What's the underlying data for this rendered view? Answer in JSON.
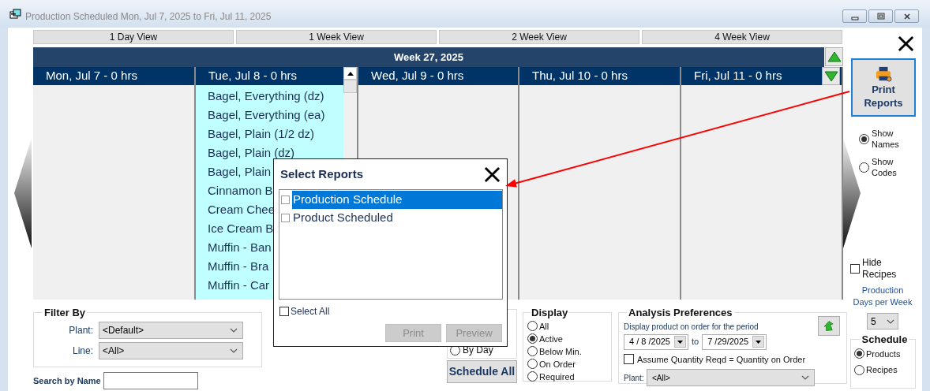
{
  "window": {
    "title": "Production Scheduled Mon, Jul 7, 2025 to Fri, Jul 11, 2025"
  },
  "view_buttons": [
    {
      "label": "1 Day View"
    },
    {
      "label": "1 Week View"
    },
    {
      "label": "2 Week View"
    },
    {
      "label": "4 Week View"
    }
  ],
  "week_header": "Week 27, 2025",
  "days": [
    {
      "header": "Mon, Jul 7 - 0 hrs"
    },
    {
      "header": "Tue, Jul 8 - 0 hrs",
      "items": [
        "Bagel, Everything (dz)",
        "Bagel, Everything (ea)",
        "Bagel, Plain (1/2 dz)",
        "Bagel, Plain (dz)",
        "Bagel, Plain",
        "Cinnamon B",
        "Cream Chee",
        "Ice Cream B",
        "Muffin - Ban",
        "Muffin - Bra",
        "Muffin - Car"
      ]
    },
    {
      "header": "Wed, Jul 9 - 0 hrs"
    },
    {
      "header": "Thu, Jul 10 - 0 hrs"
    },
    {
      "header": "Fri, Jul 11 - 0 hrs"
    }
  ],
  "print_reports_button": {
    "label": "Print Reports"
  },
  "name_display": [
    {
      "label": "Show Names",
      "selected": true
    },
    {
      "label": "Show Codes",
      "selected": false
    }
  ],
  "hide_recipes": {
    "label": "Hide Recipes",
    "checked": false
  },
  "production_days": {
    "label": "Production Days per Week",
    "value": "5"
  },
  "schedule": {
    "title": "Schedule",
    "options": [
      {
        "label": "Products",
        "selected": true
      },
      {
        "label": "Recipes",
        "selected": false
      }
    ]
  },
  "filter_by": {
    "title": "Filter By",
    "fields": [
      {
        "label": "Plant:",
        "value": "<Default>"
      },
      {
        "label": "Line:",
        "value": "<All>"
      }
    ]
  },
  "search": {
    "label": "Search by Name"
  },
  "period_group": {
    "options": [
      {
        "label": "By Day",
        "selected": false
      }
    ]
  },
  "schedule_all_button": {
    "label": "Schedule All"
  },
  "display": {
    "title": "Display",
    "options": [
      {
        "label": "All",
        "selected": false
      },
      {
        "label": "Active",
        "selected": true
      },
      {
        "label": "Below Min.",
        "selected": false
      },
      {
        "label": "On Order",
        "selected": false
      },
      {
        "label": "Required",
        "selected": false
      }
    ]
  },
  "analysis_preferences": {
    "title": "Analysis Preferences",
    "description": "Display product on order for the period",
    "from_date": "4 / 8 /2025",
    "to_label": "to",
    "to_date": "7 /29/2025",
    "assume": {
      "label": "Assume Quantity Reqd = Quantity on Order",
      "checked": false
    },
    "plant": {
      "label": "Plant:",
      "value": "<All>"
    }
  },
  "dialog": {
    "title": "Select Reports",
    "reports": [
      {
        "label": "Production Schedule",
        "checked": false,
        "selected": true
      },
      {
        "label": "Product Scheduled",
        "checked": false,
        "selected": false
      }
    ],
    "select_all": {
      "label": "Select All",
      "checked": false
    },
    "buttons": [
      {
        "label": "Print",
        "disabled": true
      },
      {
        "label": "Preview",
        "disabled": true
      }
    ]
  }
}
